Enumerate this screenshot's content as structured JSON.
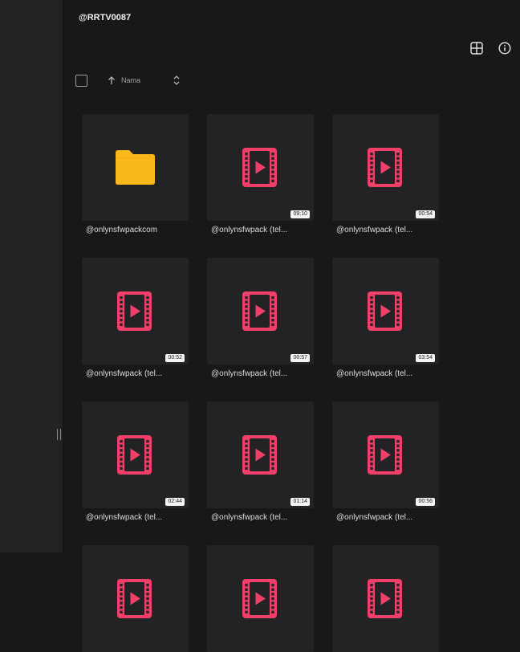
{
  "header": {
    "title": "@RRTV0087"
  },
  "toolbar": {
    "sort_label": "Nama"
  },
  "icons": {
    "view": "grid-view-icon",
    "info": "info-icon",
    "sort": "arrow-up-icon",
    "toggle": "chevron-up-down-icon"
  },
  "colors": {
    "video_icon": "#f0406a",
    "folder_icon": "#fbb81c"
  },
  "items": [
    {
      "name": "@onlynsfwpackcom",
      "type": "folder",
      "duration": ""
    },
    {
      "name": "@onlynsfwpack (tel...",
      "type": "video",
      "duration": "09:10"
    },
    {
      "name": "@onlynsfwpack (tel...",
      "type": "video",
      "duration": "00:54"
    },
    {
      "name": "@onlynsfwpack (tel...",
      "type": "video",
      "duration": "00:52"
    },
    {
      "name": "@onlynsfwpack (tel...",
      "type": "video",
      "duration": "00:57"
    },
    {
      "name": "@onlynsfwpack (tel...",
      "type": "video",
      "duration": "03:54"
    },
    {
      "name": "@onlynsfwpack (tel...",
      "type": "video",
      "duration": "02:44"
    },
    {
      "name": "@onlynsfwpack (tel...",
      "type": "video",
      "duration": "01:14"
    },
    {
      "name": "@onlynsfwpack (tel...",
      "type": "video",
      "duration": "00:56"
    },
    {
      "name": "",
      "type": "video",
      "duration": ""
    },
    {
      "name": "",
      "type": "video",
      "duration": ""
    },
    {
      "name": "",
      "type": "video",
      "duration": ""
    }
  ]
}
